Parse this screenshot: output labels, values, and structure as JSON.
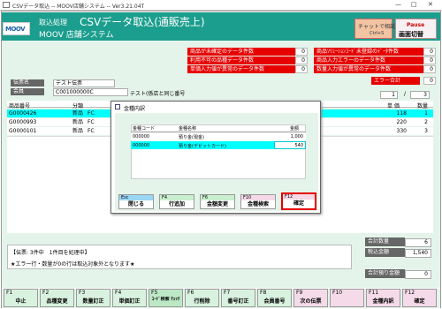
{
  "window": {
    "title": "CSVデータ取込 -- MOOV店舗システム -- Ver3.21.04T",
    "minimize": "—",
    "maximize": "□",
    "close": "✕"
  },
  "header": {
    "logo": "MOOV",
    "section": "取込処理",
    "title": "CSVデータ取込(通販売上)",
    "system": "MOOV 店舗システム",
    "chat_label": "チャットで相談",
    "chat_sub": "Ctrl+S",
    "pause_label": "Pause",
    "pause_sub": "画面切替"
  },
  "errors": {
    "left": [
      {
        "label": "商品が未確定のデータ件数",
        "count": "0"
      },
      {
        "label": "利用不可の品種データ件数",
        "count": "0"
      },
      {
        "label": "単価入力値が異常のデータ件数",
        "count": "0"
      }
    ],
    "right": [
      {
        "label": "商品ｿﾘｭｰｼｮﾝｺｰﾄﾞ未登録のﾃﾞｰﾀ件数",
        "count": "0"
      },
      {
        "label": "商品入力エラーのデータ件数",
        "count": "0"
      },
      {
        "label": "数量入力値が異常のデータ件数",
        "count": "0"
      }
    ],
    "total_label": "エラー合計",
    "total_value": "0"
  },
  "slip": {
    "slip_label": "伝票名",
    "slip_value": "テスト伝票",
    "member_label": "会員",
    "member_code": "C001000000C",
    "member_name": "テスト(係店と同じ番号",
    "page_current": "1",
    "page_sep": "/",
    "page_total": "3"
  },
  "table": {
    "headers": [
      "商品番号",
      "分類",
      "単 価",
      "数量"
    ],
    "rows": [
      {
        "code": "G0000426",
        "type": "新品",
        "cat": "FC",
        "price": "118",
        "qty": "1"
      },
      {
        "code": "G0000993",
        "type": "新品",
        "cat": "FC",
        "price": "220",
        "qty": "2"
      },
      {
        "code": "G0000101",
        "type": "新品",
        "cat": "FC",
        "price": "330",
        "qty": "3"
      }
    ]
  },
  "dialog": {
    "title": "金種内訳",
    "headers": [
      "金種コード",
      "金種名称",
      "金額"
    ],
    "rows": [
      {
        "code": "000000",
        "name": "預り金(現金)",
        "amount": "1,000"
      },
      {
        "code": "000000",
        "name": "預り金(デビットカード)",
        "amount": "540"
      }
    ],
    "buttons": [
      {
        "key": "Esc",
        "label": "閉じる"
      },
      {
        "key": "F4",
        "label": "行追加"
      },
      {
        "key": "F6",
        "label": "金額変更"
      },
      {
        "key": "F10",
        "label": "金種検索"
      },
      {
        "key": "F12",
        "label": "確定"
      }
    ]
  },
  "status": {
    "line1": "【伝票: 3件中　1件目を処理中】",
    "line2": "★エラー行・数量が0の行は取込対象外となります★"
  },
  "summary": {
    "qty_label": "合計数量",
    "qty_value": "6",
    "tax_label": "税込金額",
    "tax_value": "1,540",
    "dep_label": "合計預り金額",
    "dep_value": "0"
  },
  "fkeys": [
    {
      "key": "F1",
      "label": "中止",
      "color": "#d9f2df"
    },
    {
      "key": "F2",
      "label": "品種変更",
      "color": "#d9f2df"
    },
    {
      "key": "F3",
      "label": "数量訂正",
      "color": "#d9f2df"
    },
    {
      "key": "F4",
      "label": "単価訂正",
      "color": "#d9f2df"
    },
    {
      "key": "F5",
      "label": "ｺｰﾄﾞ検索 ﾁｪｯｸ",
      "color": "#bde8c6"
    },
    {
      "key": "F6",
      "label": "行削除",
      "color": "#d9f2df"
    },
    {
      "key": "F7",
      "label": "番号訂正",
      "color": "#d9f2df"
    },
    {
      "key": "F8",
      "label": "会員番号",
      "color": "#d9f2df"
    },
    {
      "key": "F9",
      "label": "次の伝票",
      "color": "#f5dbe9"
    },
    {
      "key": "F10",
      "label": "",
      "color": "#f5dbe9"
    },
    {
      "key": "F11",
      "label": "金種内訳",
      "color": "#f5dbe9"
    },
    {
      "key": "F12",
      "label": "確定",
      "color": "#f5dbe9"
    }
  ],
  "colors": {
    "accent": "#1b9e8e",
    "error": "#e60000",
    "selection": "#00ffff",
    "confirm_border": "#e60000"
  }
}
